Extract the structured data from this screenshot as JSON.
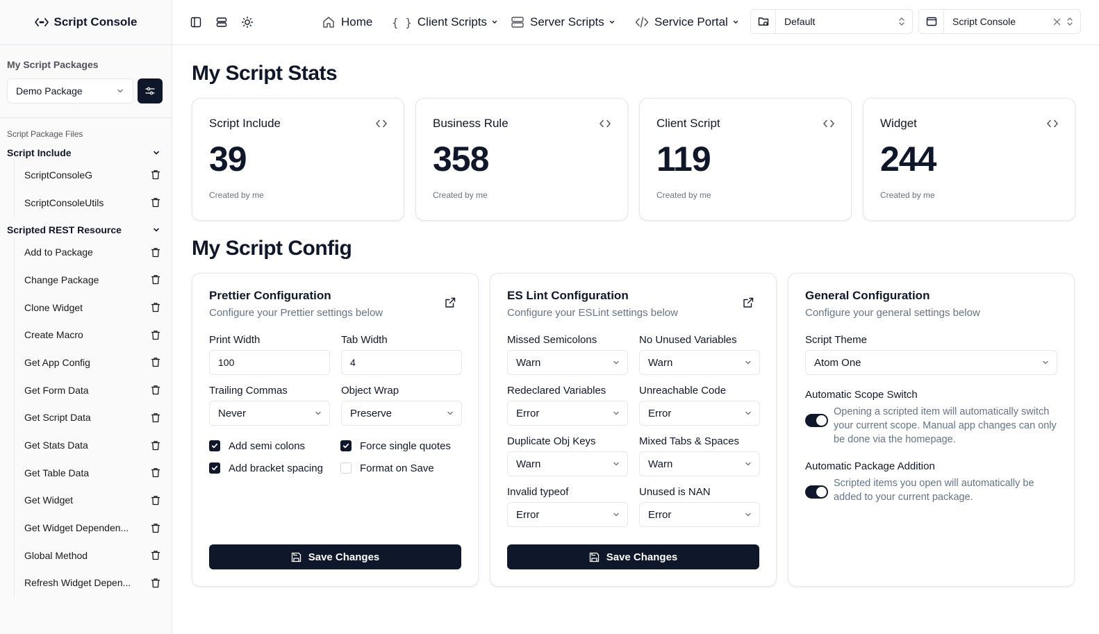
{
  "app": {
    "title": "Script Console"
  },
  "sidebar": {
    "packages_heading": "My Script Packages",
    "package_selected": "Demo Package",
    "files_label": "Script Package Files",
    "groups": [
      {
        "name": "Script Include",
        "items": [
          "ScriptConsoleG",
          "ScriptConsoleUtils"
        ]
      },
      {
        "name": "Scripted REST Resource",
        "items": [
          "Add to Package",
          "Change Package",
          "Clone Widget",
          "Create Macro",
          "Get App Config",
          "Get Form Data",
          "Get Script Data",
          "Get Stats Data",
          "Get Table Data",
          "Get Widget",
          "Get Widget Dependen...",
          "Global Method",
          "Refresh Widget Depen..."
        ]
      }
    ]
  },
  "topbar": {
    "nav": {
      "home": "Home",
      "client_scripts": "Client Scripts",
      "server_scripts": "Server Scripts",
      "service_portal": "Service Portal"
    },
    "scope_value": "Default",
    "app_value": "Script Console"
  },
  "stats": {
    "title": "My Script Stats",
    "cards": [
      {
        "label": "Script Include",
        "value": "39",
        "sub": "Created by me"
      },
      {
        "label": "Business Rule",
        "value": "358",
        "sub": "Created by me"
      },
      {
        "label": "Client Script",
        "value": "119",
        "sub": "Created by me"
      },
      {
        "label": "Widget",
        "value": "244",
        "sub": "Created by me"
      }
    ]
  },
  "config": {
    "title": "My Script Config",
    "prettier": {
      "title": "Prettier Configuration",
      "desc": "Configure your Prettier settings below",
      "print_width_label": "Print Width",
      "print_width": "100",
      "tab_width_label": "Tab Width",
      "tab_width": "4",
      "trailing_commas_label": "Trailing Commas",
      "trailing_commas": "Never",
      "object_wrap_label": "Object Wrap",
      "object_wrap": "Preserve",
      "checks": [
        {
          "label": "Add semi colons",
          "checked": true
        },
        {
          "label": "Force single quotes",
          "checked": true
        },
        {
          "label": "Add bracket spacing",
          "checked": true
        },
        {
          "label": "Format on Save",
          "checked": false
        }
      ],
      "save_label": "Save Changes"
    },
    "eslint": {
      "title": "ES Lint Configuration",
      "desc": "Configure your ESLint settings below",
      "fields": [
        {
          "label": "Missed Semicolons",
          "value": "Warn"
        },
        {
          "label": "No Unused Variables",
          "value": "Warn"
        },
        {
          "label": "Redeclared Variables",
          "value": "Error"
        },
        {
          "label": "Unreachable Code",
          "value": "Error"
        },
        {
          "label": "Duplicate Obj Keys",
          "value": "Warn"
        },
        {
          "label": "Mixed Tabs & Spaces",
          "value": "Warn"
        },
        {
          "label": "Invalid typeof",
          "value": "Error"
        },
        {
          "label": "Unused is NAN",
          "value": "Error"
        }
      ],
      "save_label": "Save Changes"
    },
    "general": {
      "title": "General Configuration",
      "desc": "Configure your general settings below",
      "theme_label": "Script Theme",
      "theme_value": "Atom One",
      "scope_switch_label": "Automatic Scope Switch",
      "scope_switch_desc": "Opening a scripted item will automatically switch your current scope. Manual app changes can only be done via the homepage.",
      "scope_switch_on": true,
      "pkg_add_label": "Automatic Package Addition",
      "pkg_add_desc": "Scripted items you open will automatically be added to your current package.",
      "pkg_add_on": true
    }
  }
}
